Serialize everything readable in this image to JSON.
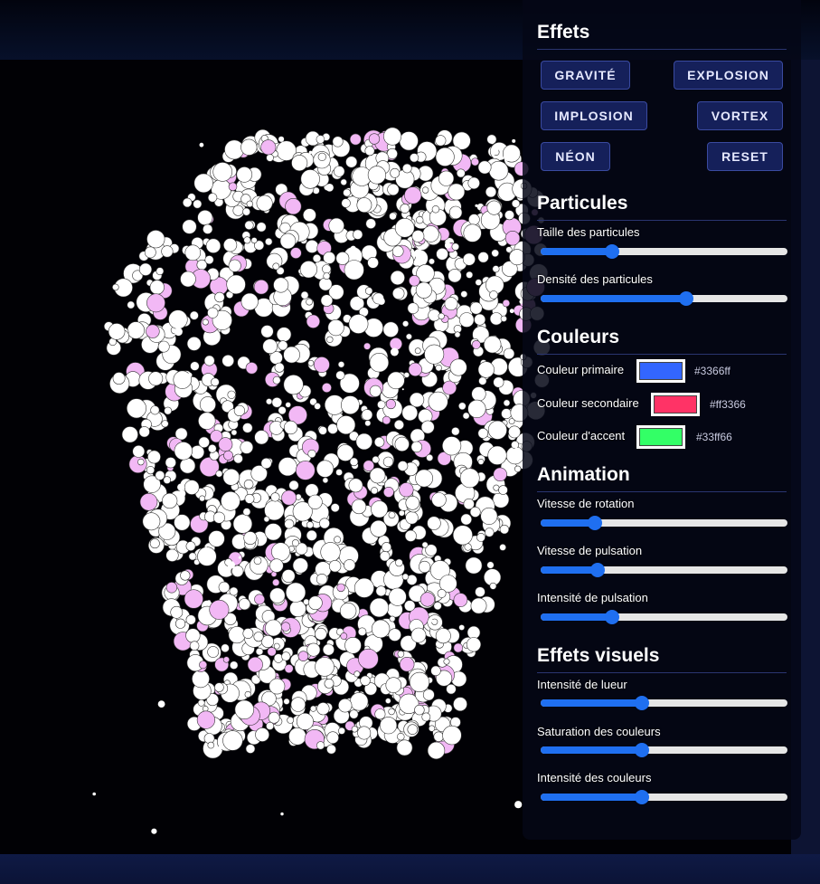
{
  "panel": {
    "effects": {
      "title": "Effets",
      "buttons": {
        "gravity": "GRAVITÉ",
        "explosion": "EXPLOSION",
        "implosion": "IMPLOSION",
        "vortex": "VORTEX",
        "neon": "NÉON",
        "reset": "RESET"
      }
    },
    "particles": {
      "title": "Particules",
      "size_label": "Taille des particules",
      "size_value": 0.29,
      "density_label": "Densité des particules",
      "density_value": 0.59
    },
    "colors": {
      "title": "Couleurs",
      "primary_label": "Couleur primaire",
      "primary_value": "#3366ff",
      "secondary_label": "Couleur secondaire",
      "secondary_value": "#ff3366",
      "accent_label": "Couleur d'accent",
      "accent_value": "#33ff66"
    },
    "animation": {
      "title": "Animation",
      "rotation_label": "Vitesse de rotation",
      "rotation_value": 0.22,
      "pulse_speed_label": "Vitesse de pulsation",
      "pulse_speed_value": 0.23,
      "pulse_intensity_label": "Intensité de pulsation",
      "pulse_intensity_value": 0.29
    },
    "visual": {
      "title": "Effets visuels",
      "glow_label": "Intensité de lueur",
      "glow_value": 0.41,
      "saturation_label": "Saturation des couleurs",
      "saturation_value": 0.41,
      "color_intensity_label": "Intensité des couleurs",
      "color_intensity_value": 0.41
    }
  },
  "colors": {
    "background": "#010105",
    "slider_fill": "#1f6ff0",
    "particle_white": "#ffffff",
    "particle_pink": "#f2b8f5"
  }
}
